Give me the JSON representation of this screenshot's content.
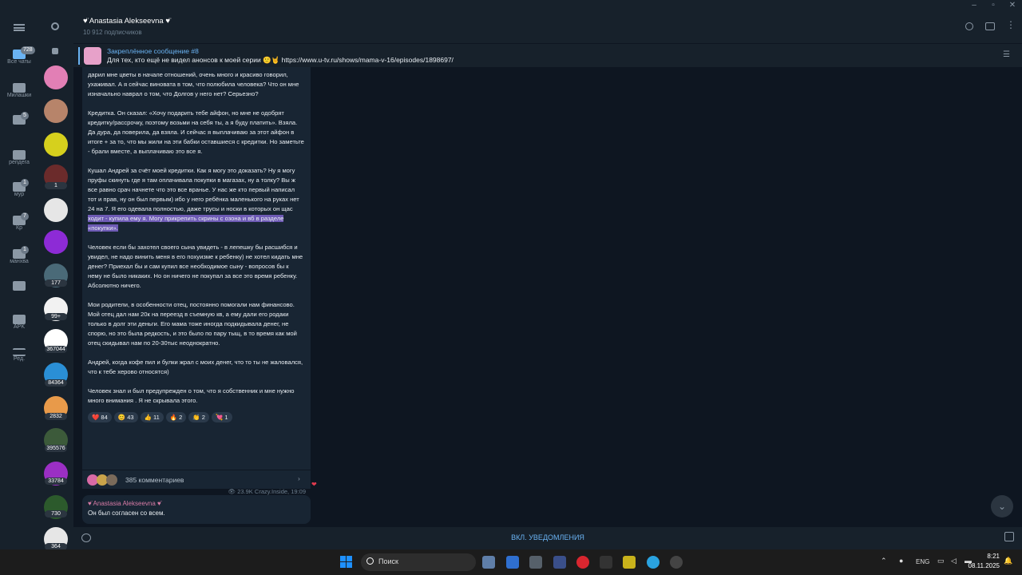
{
  "channel": {
    "name": "♥̈ Anastasia Alekseevna ♥̈",
    "subscribers": "10 912 подписчиков"
  },
  "folders": [
    {
      "label": "Все чаты",
      "badge": "728"
    },
    {
      "label": "Милашки",
      "badge": ""
    },
    {
      "label": "",
      "badge": "5"
    },
    {
      "label": "репдега",
      "badge": ""
    },
    {
      "label": "мур",
      "badge": "1"
    },
    {
      "label": "Кр",
      "badge": "7"
    },
    {
      "label": "манхва",
      "badge": "1"
    },
    {
      "label": "",
      "badge": ""
    },
    {
      "label": "APK",
      "badge": ""
    },
    {
      "label": "Ред.",
      "badge": ""
    }
  ],
  "chat_badges": [
    "",
    "",
    "",
    "1",
    "",
    "",
    "177",
    "99+",
    "367044",
    "84364",
    "2832",
    "395576",
    "33784",
    "730",
    "364"
  ],
  "pinned": {
    "title": "Закреплённое сообщение #8",
    "text": "Для тех, кто ещё не видел анонсов к моей серии 🙂🤘 https://www.u-tv.ru/shows/mama-v-16/episodes/1898697/"
  },
  "message": {
    "p0": "дарил мне цветы в начале отношений, очень много и красиво говорил, ухаживал. А я сейчас виновата в том, что полюбила человека? Что он мне изначально наврал о том, что Долгов у него нет? Серьезно?",
    "p1": "Кредитка. Он сказал: «Хочу подарить тебе айфон, но мне не одобрят кредитку/рассрочку, поэтому возьми на себя ты, а я буду платить». Взяла. Да дура, да поверила, да взяла. И сейчас я выплачиваю за этот айфон в итоге + за то, что мы жили на эти бабки оставшиеся с кредитки. Но заметьте - брали вместе, а выплачиваю это все я.",
    "p2a": "Кушал Андрей за счёт моей кредитки. Как я могу это доказать? Ну я могу пруфы скинуть где я там оплачивала покупки в магазах, ну а толку? Вы ж все равно срач начнете что это все вранье. У нас же кто первый написал тот и прав, ну он был первым) ибо у него ребёнка маленького на руках нет 24 на 7. Я его одевала полностью, даже трусы и носки в которых он щас",
    "p2b": "ходит - купила ему я. Могу прикрепить скрины с озона и вб в разделе «покупки».",
    "p3": "Человек если бы захотел своего сына увидеть - в лепешку бы расшибся и увидел, не надо винить меня в его похуизме к ребенку) не хотел кидать мне денег? Приехал бы и сам купил все необходимое сыну - вопросов бы к нему не было никаких. Но он ничего не покупал за все это время ребенку. Абсолютно ничего.",
    "p4": "Мои родители, в особенности отец, постоянно помогали нам финансово. Мой отец дал нам 20к на переезд в съемную кв, а ему дали его родаки только в долг эти деньги. Его мама тоже иногда подкидывала денег, не спорю, но это была редкость, и это было по пару тыщ, в то время как мой отец скидывал нам по 20-30тыс неоднократно.",
    "p5": "Андрей, когда кофе пил и булки жрал с моих денег, что то ты не жаловался, что к тебе херово относятся)",
    "p6": "Человек знал и был предупрежден о том, что я собственник и мне нужно много внимания . Я не скрывала этого.",
    "reactions": [
      "❤️ 84",
      "😊 43",
      "👍 11",
      "🔥 2",
      "👏 2",
      "💘 1"
    ],
    "views": "23.9K",
    "author": "Crazy.Inside",
    "time": "19:09",
    "comments": "385 комментариев"
  },
  "next_message": {
    "author": "♥̈ Anastasia Alekseevna ♥̈",
    "text": "Он был согласен со всем."
  },
  "bottom": {
    "notify": "ВКЛ. УВЕДОМЛЕНИЯ"
  },
  "taskbar": {
    "search": "Поиск",
    "lang": "ENG",
    "time": "8:21",
    "date": "08.11.2025"
  },
  "colors": {
    "bg": "#0e1621",
    "panel": "#17212b",
    "bubble": "#182533",
    "accent": "#6ab3f3",
    "highlight": "#6e5bb5"
  }
}
